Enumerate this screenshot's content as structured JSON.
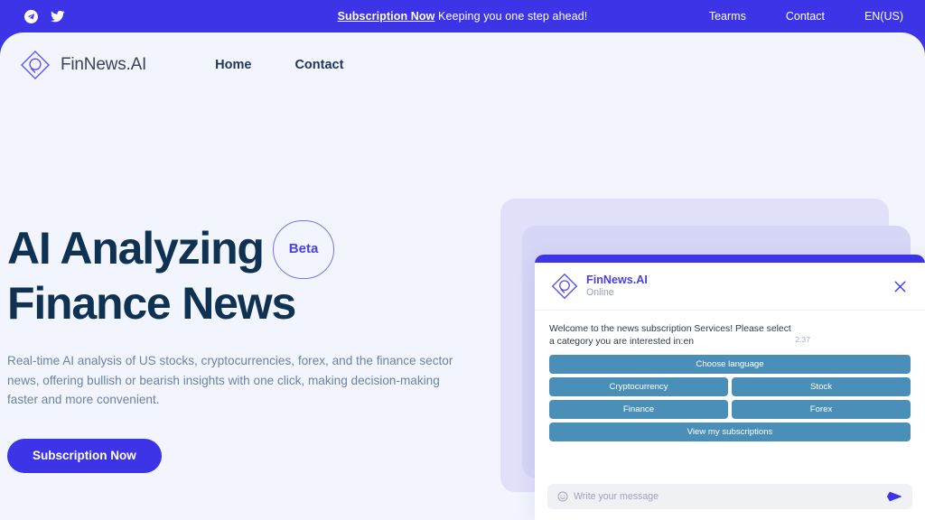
{
  "announcement_bar": {
    "social": [
      {
        "icon": "telegram-icon",
        "name": "Telegram"
      },
      {
        "icon": "twitter-icon",
        "name": "Twitter"
      }
    ],
    "link_label": "Subscription Now",
    "tagline": " Keeping you one step ahead!",
    "links": [
      {
        "label": "Tearms"
      },
      {
        "label": "Contact"
      },
      {
        "label": "EN(US)"
      }
    ]
  },
  "nav": {
    "brand": "FinNews.AI",
    "links": [
      {
        "label": "Home"
      },
      {
        "label": "Contact"
      }
    ]
  },
  "hero": {
    "heading_line1": "AI Analyzing",
    "badge": "Beta",
    "heading_line2": "Finance News",
    "paragraph": "Real-time AI analysis of US stocks, cryptocurrencies, forex, and the finance sector news, offering bullish or bearish insights with one click, making decision-making faster and more convenient.",
    "cta_label": "Subscription Now"
  },
  "chat_widget": {
    "title": "FinNews.AI",
    "status": "Online",
    "close_label": "✕",
    "message": "Welcome to the news subscription Services! Please select a category you are interested in:en",
    "message_time": "2:37",
    "quick_replies": [
      [
        "Choose language"
      ],
      [
        "Cryptocurrency",
        "Stock"
      ],
      [
        "Finance",
        "Forex"
      ],
      [
        "View my subscriptions"
      ]
    ],
    "input_placeholder": "Write your message",
    "input_value": ""
  },
  "colors": {
    "brand_blue": "#3d34e8",
    "page_bg": "#f2f5fd",
    "heading_navy": "#0f3253",
    "body_text": "#6c82a4",
    "chat_button": "#4a8fb8",
    "deco_back": "#e0e0fa",
    "deco_mid": "#d6d6f7"
  }
}
